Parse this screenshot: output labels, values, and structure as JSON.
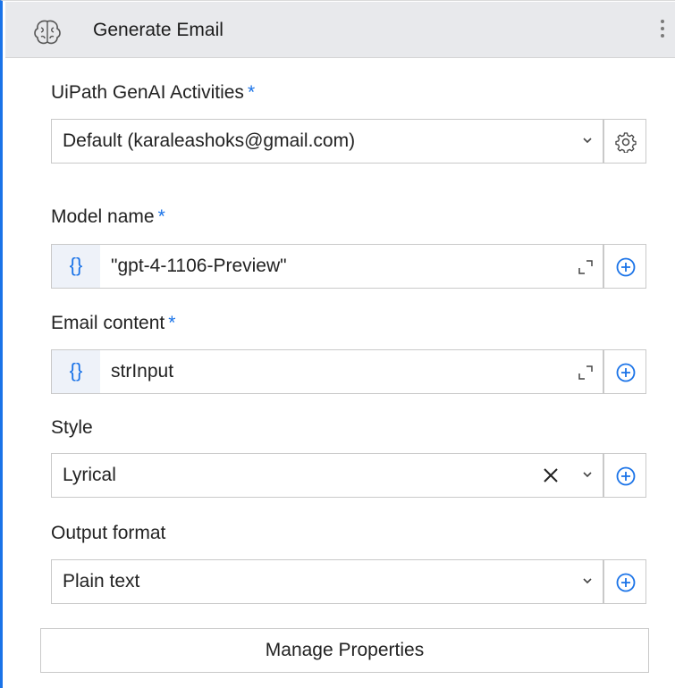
{
  "header": {
    "title": "Generate Email",
    "icon": "brain-icon",
    "menu_icon": "kebab-menu-icon"
  },
  "fields": {
    "connection": {
      "label": "UiPath GenAI Activities",
      "required_mark": "*",
      "value": "Default (karaleashoks@gmail.com)"
    },
    "model_name": {
      "label": "Model name",
      "required_mark": "*",
      "brace": "{}",
      "value": "\"gpt-4-1106-Preview\""
    },
    "email_content": {
      "label": "Email content",
      "required_mark": "*",
      "brace": "{}",
      "value": "strInput"
    },
    "style": {
      "label": "Style",
      "value": "Lyrical"
    },
    "output_format": {
      "label": "Output format",
      "value": "Plain text"
    }
  },
  "manage_button": "Manage Properties",
  "colors": {
    "accent": "#1a73e8",
    "header_bg": "#e8e9ec",
    "brace_bg": "#eef2f9",
    "border": "#c9c9c9"
  }
}
